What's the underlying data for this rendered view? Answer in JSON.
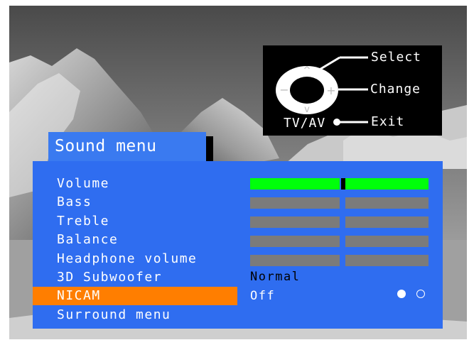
{
  "help": {
    "select_label": "Select",
    "change_label": "Change",
    "exit_label": "Exit",
    "tvav_label": "TV/AV"
  },
  "menu": {
    "title": "Sound menu",
    "items": [
      {
        "label": "Volume"
      },
      {
        "label": "Bass"
      },
      {
        "label": "Treble"
      },
      {
        "label": "Balance"
      },
      {
        "label": "Headphone volume"
      },
      {
        "label": "3D Subwoofer"
      },
      {
        "label": "NICAM"
      },
      {
        "label": "Surround menu"
      }
    ],
    "selected_item": "NICAM",
    "values": {
      "volume_level": 0.52,
      "subwoofer_value": "Normal",
      "nicam_value": "Off",
      "nicam_dots": [
        "filled",
        "hollow"
      ]
    }
  },
  "colors": {
    "menu_background": "#2f6df0",
    "title_background": "#3a7af0",
    "selection_highlight": "#ff7e00",
    "active_bar": "#00ff0a",
    "inactive_bar": "#7b7b7b",
    "value_text_normal": "#000000",
    "value_text_selected": "#ffffff"
  }
}
